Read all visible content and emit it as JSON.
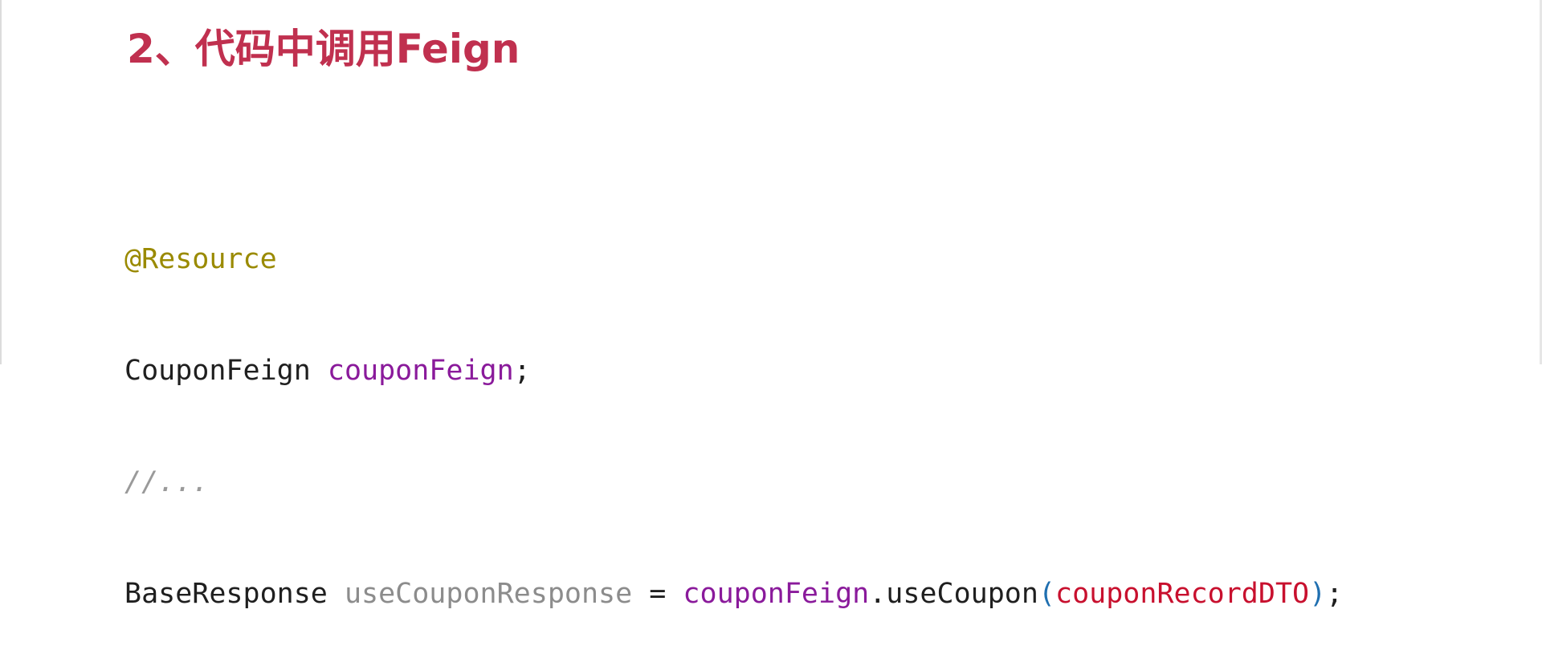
{
  "heading": "2、代码中调用Feign",
  "code": {
    "line1": {
      "annotation": "@Resource"
    },
    "line2": {
      "type": "CouponFeign",
      "field": "couponFeign",
      "end": ";"
    },
    "line3": {
      "comment": "//..."
    },
    "line4": {
      "type": "BaseResponse",
      "local": "useCouponResponse",
      "op": "=",
      "target": "couponFeign",
      "method": ".useCoupon",
      "open_paren": "(",
      "arg": "couponRecordDTO",
      "close_paren": ")",
      "end": ";"
    }
  },
  "colors": {
    "heading": "#c0304f",
    "annotation": "#9a8a00",
    "field": "#8a1a9b",
    "comment": "#9a9a9a",
    "local": "#8c8c8c",
    "paren": "#1f6fb0",
    "argument": "#c8102e",
    "text": "#1f1f1f"
  }
}
